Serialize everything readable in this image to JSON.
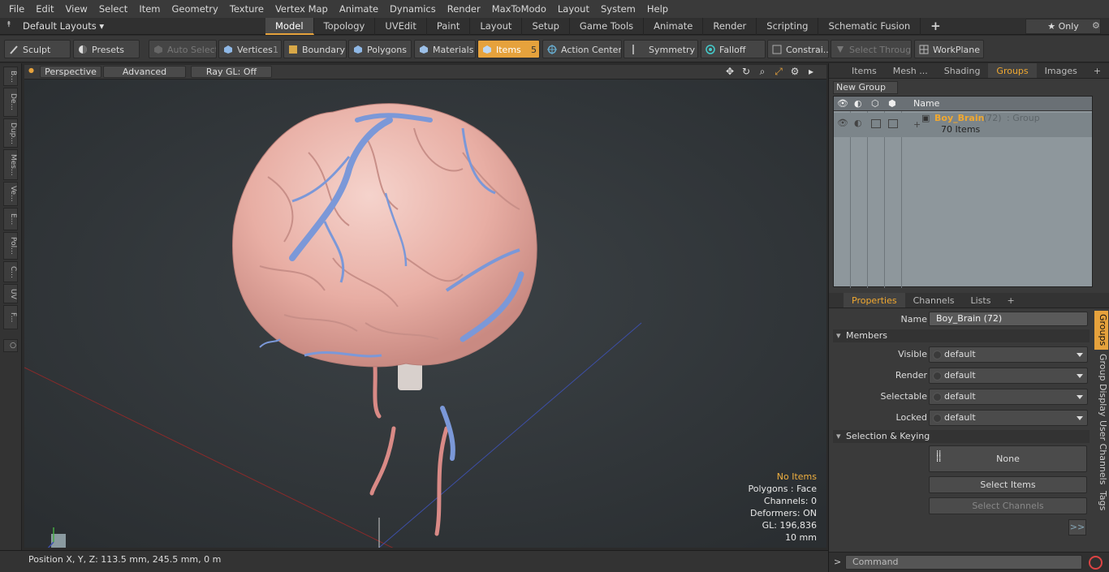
{
  "menubar": [
    "File",
    "Edit",
    "View",
    "Select",
    "Item",
    "Geometry",
    "Texture",
    "Vertex Map",
    "Animate",
    "Dynamics",
    "Render",
    "MaxToModo",
    "Layout",
    "System",
    "Help"
  ],
  "layouts": {
    "label": "Default Layouts ▾"
  },
  "layout_tabs": [
    "Model",
    "Topology",
    "UVEdit",
    "Paint",
    "Layout",
    "Setup",
    "Game Tools",
    "Animate",
    "Render",
    "Scripting",
    "Schematic Fusion"
  ],
  "only_label": "★  Only",
  "toolbar": {
    "sculpt": "Sculpt",
    "presets": "Presets",
    "auto_select": "Auto Select",
    "vertices": "Vertices",
    "vertices_count": "1",
    "boundary": "Boundary",
    "polygons": "Polygons",
    "materials": "Materials",
    "items": "Items",
    "items_count": "5",
    "action_center": "Action Center",
    "symmetry": "Symmetry",
    "falloff": "Falloff",
    "constraints": "Constrai...",
    "select_through": "Select Through",
    "workplane": "WorkPlane"
  },
  "left_tabs": [
    "B...",
    "De...",
    "Dup...",
    "Mes...",
    "Ve...",
    "E...",
    "Pol...",
    "C...",
    "UV",
    "F..."
  ],
  "viewport": {
    "perspective": "Perspective",
    "advanced": "Advanced",
    "raygl": "Ray GL: Off",
    "stats": {
      "no_items": "No Items",
      "polygons": "Polygons : Face",
      "channels": "Channels: 0",
      "deformers": "Deformers: ON",
      "gl": "GL: 196,836",
      "scale": "10 mm"
    }
  },
  "status": {
    "position": "Position X, Y, Z:   113.5 mm, 245.5 mm, 0 m"
  },
  "groups_panel": {
    "tabs": [
      "Items",
      "Mesh ...",
      "Shading",
      "Groups",
      "Images"
    ],
    "new_group": "New Group",
    "name_col": "Name",
    "group_name": "Boy_Brain",
    "group_count": "(72)",
    "group_type": ": Group",
    "group_items": "70 Items"
  },
  "properties_panel": {
    "tabs": [
      "Properties",
      "Channels",
      "Lists"
    ],
    "name_label": "Name",
    "name_value": "Boy_Brain (72)",
    "members": "Members",
    "rows": [
      {
        "label": "Visible",
        "value": "default"
      },
      {
        "label": "Render",
        "value": "default"
      },
      {
        "label": "Selectable",
        "value": "default"
      },
      {
        "label": "Locked",
        "value": "default"
      }
    ],
    "sel_keying": "Selection & Keying",
    "none": "None",
    "select_items": "Select Items",
    "select_channels": "Select Channels",
    "more": ">>",
    "side_tabs": [
      "Groups",
      "Group Display",
      "User Channels",
      "Tags"
    ]
  },
  "command": {
    "placeholder": "Command"
  }
}
